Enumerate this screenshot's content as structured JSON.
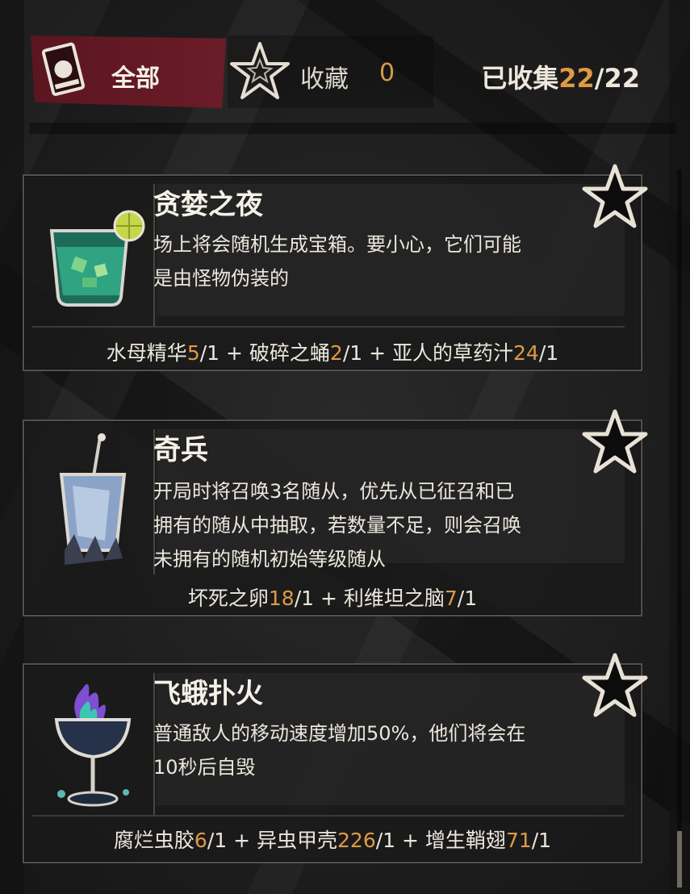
{
  "header": {
    "tab_all_label": "全部",
    "tab_fav_label": "收藏",
    "tab_fav_count": "0",
    "collected_prefix": "已收集",
    "collected_count": "22",
    "collected_sep": "/",
    "collected_total": "22"
  },
  "cards": [
    {
      "title": "贪婪之夜",
      "desc_lines": [
        "场上将会随机生成宝箱。要小心，它们可能",
        "是由怪物伪装的"
      ],
      "icon": "cocktail-glass-icon",
      "recipe": [
        {
          "name": "水母精华",
          "num": "5",
          "den": "/1"
        },
        {
          "name": "破碎之蛹",
          "num": "2",
          "den": "/1"
        },
        {
          "name": "亚人的草药汁",
          "num": "24",
          "den": "/1"
        }
      ]
    },
    {
      "title": "奇兵",
      "desc_lines": [
        "开局时将召唤3名随从，优先从已征召和已",
        "拥有的随从中抽取，若数量不足，则会召唤",
        "未拥有的随机初始等级随从"
      ],
      "icon": "crystal-glass-icon",
      "recipe": [
        {
          "name": "坏死之卵",
          "num": "18",
          "den": "/1"
        },
        {
          "name": "利维坦之脑",
          "num": "7",
          "den": "/1"
        }
      ]
    },
    {
      "title": "飞蛾扑火",
      "desc_lines": [
        "普通敌人的移动速度增加50%，他们将会在",
        "10秒后自毁"
      ],
      "icon": "flame-goblet-icon",
      "recipe": [
        {
          "name": "腐烂虫胶",
          "num": "6",
          "den": "/1"
        },
        {
          "name": "异虫甲壳",
          "num": "226",
          "den": "/1"
        },
        {
          "name": "增生鞘翅",
          "num": "71",
          "den": "/1"
        }
      ]
    }
  ],
  "colors": {
    "accent": "#e09a45",
    "tab_active": "#6b1c28",
    "text": "#ece7dd"
  }
}
